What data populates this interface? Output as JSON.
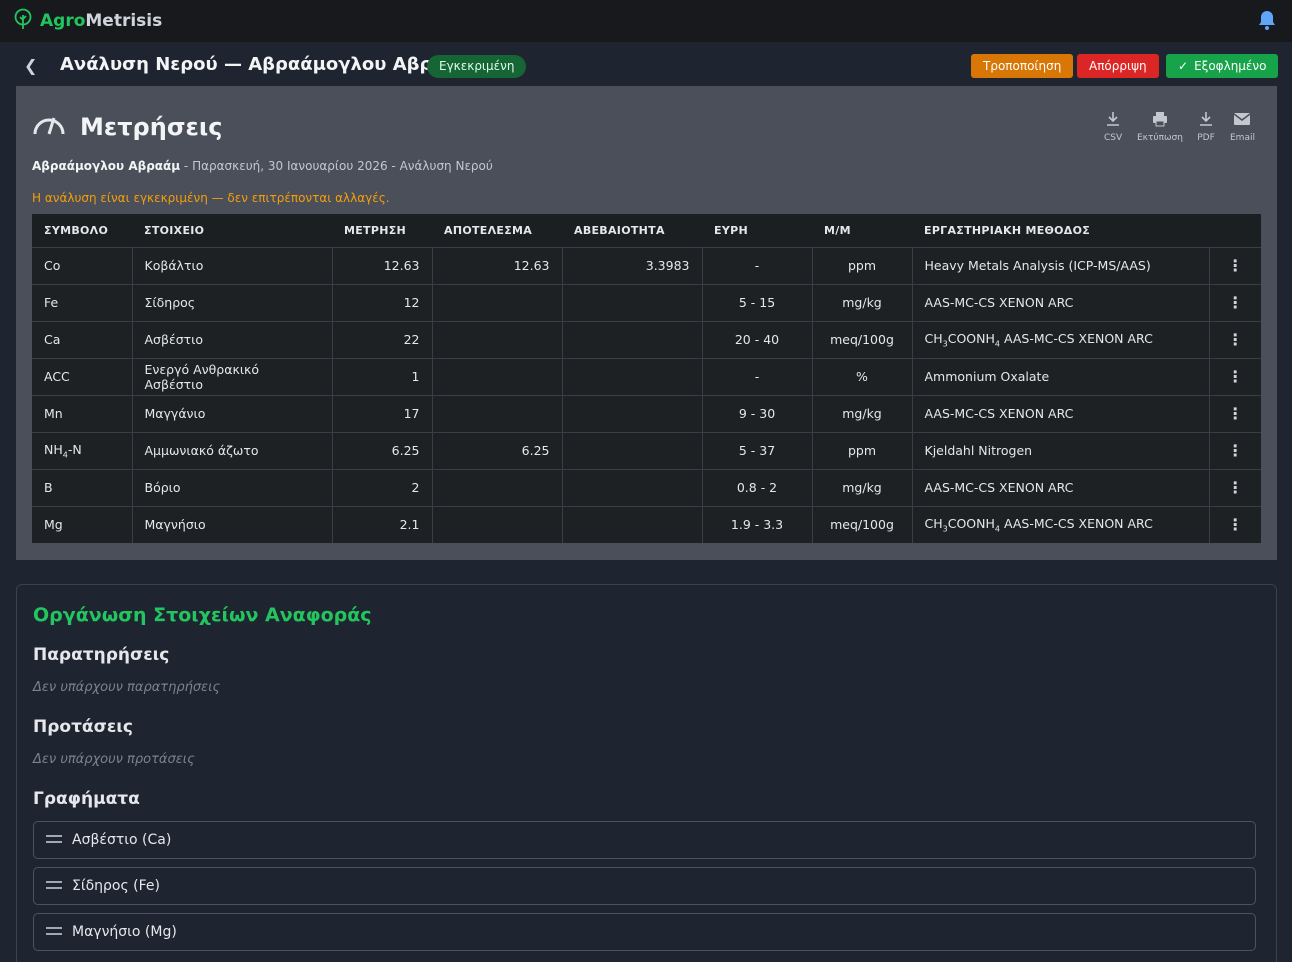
{
  "app": {
    "brand_part1": "Agro",
    "brand_part2": "Metrisis"
  },
  "header": {
    "title": "Ανάλυση Νερού — Αβραάμογλου Αβραάμ",
    "status": "Εγκεκριμένη",
    "buttons": {
      "modify": "Τροποποίηση",
      "reject": "Απόρριψη",
      "paid": "Εξοφλημένο"
    }
  },
  "measurements": {
    "title": "Μετρήσεις",
    "customer": "Αβραάμογλου Αβραάμ",
    "details": " - Παρασκευή, 30 Ιανουαρίου 2026 - Ανάλυση Νερού",
    "warning": "Η ανάλυση είναι εγκεκριμένη — δεν επιτρέπονται αλλαγές.",
    "tools": {
      "csv": "CSV",
      "print": "Εκτύπωση",
      "pdf": "PDF",
      "email": "Email"
    },
    "columns": [
      "ΣΥΜΒΟΛΟ",
      "ΣΤΟΙΧΕΙΟ",
      "ΜΕΤΡΗΣΗ",
      "ΑΠΟΤΕΛΕΣΜΑ",
      "ΑΒΕΒΑΙΟΤΗΤΑ",
      "ΕΥΡΗ",
      "Μ/Μ",
      "ΕΡΓΑΣΤΗΡΙΑΚΗ ΜΕΘΟΔΟΣ"
    ],
    "rows": [
      {
        "symbol": "Co",
        "element": "Κοβάλτιο",
        "measurement": "12.63",
        "result": "12.63",
        "uncertainty": "3.3983",
        "range": "-",
        "unit": "ppm",
        "method": "Heavy Metals Analysis (ICP-MS/AAS)"
      },
      {
        "symbol": "Fe",
        "element": "Σίδηρος",
        "measurement": "12",
        "result": "",
        "uncertainty": "",
        "range": "5 - 15",
        "unit": "mg/kg",
        "method": "AAS-MC-CS XENON ARC"
      },
      {
        "symbol": "Ca",
        "element": "Ασβέστιο",
        "measurement": "22",
        "result": "",
        "uncertainty": "",
        "range": "20 - 40",
        "unit": "meq/100g",
        "method": "CH3COONH4 AAS-MC-CS XENON ARC"
      },
      {
        "symbol": "ACC",
        "element": "Ενεργό Ανθρακικό Ασβέστιο",
        "measurement": "1",
        "result": "",
        "uncertainty": "",
        "range": "-",
        "unit": "%",
        "method": "Ammonium Oxalate"
      },
      {
        "symbol": "Mn",
        "element": "Μαγγάνιο",
        "measurement": "17",
        "result": "",
        "uncertainty": "",
        "range": "9 - 30",
        "unit": "mg/kg",
        "method": "AAS-MC-CS XENON ARC"
      },
      {
        "symbol": "NH4-N",
        "element": "Αμμωνιακό άζωτο",
        "measurement": "6.25",
        "result": "6.25",
        "uncertainty": "",
        "range": "5 - 37",
        "unit": "ppm",
        "method": "Kjeldahl Nitrogen"
      },
      {
        "symbol": "B",
        "element": "Βόριο",
        "measurement": "2",
        "result": "",
        "uncertainty": "",
        "range": "0.8 - 2",
        "unit": "mg/kg",
        "method": "AAS-MC-CS XENON ARC"
      },
      {
        "symbol": "Mg",
        "element": "Μαγνήσιο",
        "measurement": "2.1",
        "result": "",
        "uncertainty": "",
        "range": "1.9 - 3.3",
        "unit": "meq/100g",
        "method": "CH3COONH4 AAS-MC-CS XENON ARC"
      }
    ]
  },
  "report": {
    "title": "Οργάνωση Στοιχείων Αναφοράς",
    "observations_title": "Παρατηρήσεις",
    "observations_empty": "Δεν υπάρχουν παρατηρήσεις",
    "suggestions_title": "Προτάσεις",
    "suggestions_empty": "Δεν υπάρχουν προτάσεις",
    "charts_title": "Γραφήματα",
    "charts": [
      "Ασβέστιο (Ca)",
      "Σίδηρος (Fe)",
      "Μαγνήσιο (Mg)"
    ]
  },
  "colors": {
    "accent": "#22c55e",
    "warning": "#f59e0b",
    "modify": "#d97706",
    "reject": "#dc2626",
    "paid": "#16a34a"
  }
}
